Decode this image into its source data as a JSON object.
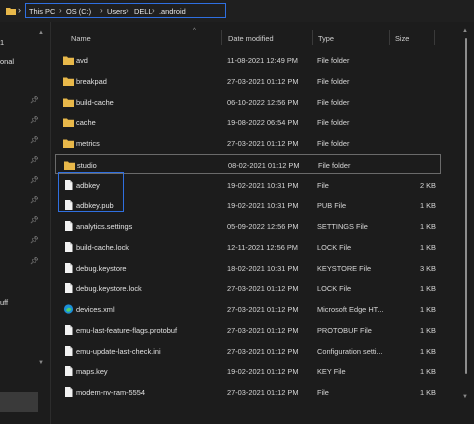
{
  "breadcrumb": [
    "This PC",
    "OS (C:)",
    "Users",
    "DELL",
    ".android"
  ],
  "sidebar": {
    "fragments": [
      "1",
      "onal",
      "uff"
    ]
  },
  "columns": {
    "name": "Name",
    "date": "Date modified",
    "type": "Type",
    "size": "Size"
  },
  "files": [
    {
      "name": "avd",
      "date": "11-08-2021 12:49 PM",
      "type": "File folder",
      "size": "",
      "icon": "folder-icon"
    },
    {
      "name": "breakpad",
      "date": "27-03-2021 01:12 PM",
      "type": "File folder",
      "size": "",
      "icon": "folder-icon"
    },
    {
      "name": "build-cache",
      "date": "06-10-2022 12:56 PM",
      "type": "File folder",
      "size": "",
      "icon": "folder-icon"
    },
    {
      "name": "cache",
      "date": "19-08-2022 06:54 PM",
      "type": "File folder",
      "size": "",
      "icon": "folder-icon"
    },
    {
      "name": "metrics",
      "date": "27-03-2021 01:12 PM",
      "type": "File folder",
      "size": "",
      "icon": "folder-icon"
    },
    {
      "name": "studio",
      "date": "08-02-2021 01:12 PM",
      "type": "File folder",
      "size": "",
      "icon": "folder-icon"
    },
    {
      "name": "adbkey",
      "date": "19-02-2021 10:31 PM",
      "type": "File",
      "size": "2 KB",
      "icon": "file-icon"
    },
    {
      "name": "adbkey.pub",
      "date": "19-02-2021 10:31 PM",
      "type": "PUB File",
      "size": "1 KB",
      "icon": "file-icon"
    },
    {
      "name": "analytics.settings",
      "date": "05-09-2022 12:56 PM",
      "type": "SETTINGS File",
      "size": "1 KB",
      "icon": "file-icon"
    },
    {
      "name": "build-cache.lock",
      "date": "12-11-2021 12:56 PM",
      "type": "LOCK File",
      "size": "1 KB",
      "icon": "file-icon"
    },
    {
      "name": "debug.keystore",
      "date": "18-02-2021 10:31 PM",
      "type": "KEYSTORE File",
      "size": "3 KB",
      "icon": "file-icon"
    },
    {
      "name": "debug.keystore.lock",
      "date": "27-03-2021 01:12 PM",
      "type": "LOCK File",
      "size": "1 KB",
      "icon": "file-icon"
    },
    {
      "name": "devices.xml",
      "date": "27-03-2021 01:12 PM",
      "type": "Microsoft Edge HT...",
      "size": "1 KB",
      "icon": "edge-icon"
    },
    {
      "name": "emu-last-feature-flags.protobuf",
      "date": "27-03-2021 01:12 PM",
      "type": "PROTOBUF File",
      "size": "1 KB",
      "icon": "file-icon"
    },
    {
      "name": "emu-update-last-check.ini",
      "date": "27-03-2021 01:12 PM",
      "type": "Configuration setti...",
      "size": "1 KB",
      "icon": "file-icon"
    },
    {
      "name": "maps.key",
      "date": "19-02-2021 01:12 PM",
      "type": "KEY File",
      "size": "1 KB",
      "icon": "file-icon"
    },
    {
      "name": "modem-nv-ram-5554",
      "date": "27-03-2021 01:12 PM",
      "type": "File",
      "size": "1 KB",
      "icon": "file-icon"
    }
  ],
  "selected_index": 5,
  "highlighted_indices": [
    6,
    7
  ],
  "colors": {
    "accent": "#2f6fe0",
    "folder": "#e8b84a",
    "background": "#1c1c1c"
  }
}
